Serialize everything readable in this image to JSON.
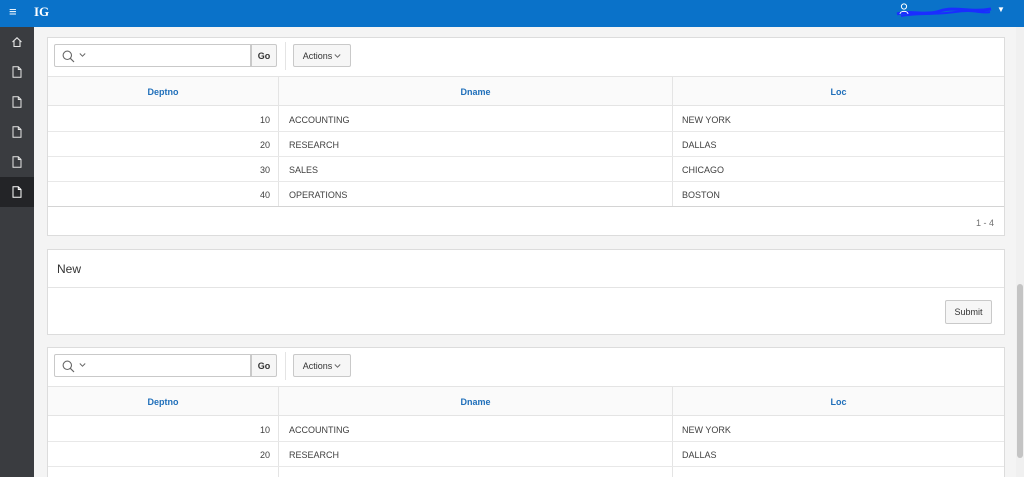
{
  "app": {
    "title": "IG",
    "user_name": ""
  },
  "colors": {
    "header": "#0a72c9",
    "nav": "#3a3c40",
    "link": "#1f6fba"
  },
  "sidebar": {
    "items": [
      {
        "icon": "home-icon"
      },
      {
        "icon": "page-icon"
      },
      {
        "icon": "page-icon"
      },
      {
        "icon": "page-icon"
      },
      {
        "icon": "page-icon"
      },
      {
        "icon": "page-icon",
        "active": true
      }
    ]
  },
  "grid1": {
    "search_placeholder": "",
    "go_label": "Go",
    "actions_label": "Actions",
    "columns": [
      "Deptno",
      "Dname",
      "Loc"
    ],
    "rows": [
      {
        "deptno": "10",
        "dname": "ACCOUNTING",
        "loc": "NEW YORK"
      },
      {
        "deptno": "20",
        "dname": "RESEARCH",
        "loc": "DALLAS"
      },
      {
        "deptno": "30",
        "dname": "SALES",
        "loc": "CHICAGO"
      },
      {
        "deptno": "40",
        "dname": "OPERATIONS",
        "loc": "BOSTON"
      }
    ],
    "pagination": "1 - 4"
  },
  "new_region": {
    "title": "New",
    "submit_label": "Submit"
  },
  "grid2": {
    "search_placeholder": "",
    "go_label": "Go",
    "actions_label": "Actions",
    "columns": [
      "Deptno",
      "Dname",
      "Loc"
    ],
    "rows": [
      {
        "deptno": "10",
        "dname": "ACCOUNTING",
        "loc": "NEW YORK"
      },
      {
        "deptno": "20",
        "dname": "RESEARCH",
        "loc": "DALLAS"
      }
    ]
  }
}
